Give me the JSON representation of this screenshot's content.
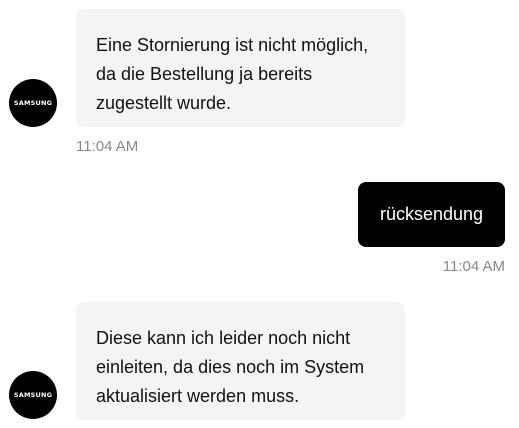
{
  "agent": {
    "name": "SAMSUNG",
    "avatar_icon": "samsung-logo-icon",
    "avatar_color": "#000000"
  },
  "messages": [
    {
      "sender": "agent",
      "text": "Eine Stornierung ist nicht möglich,\nda die Bestellung ja bereits\nzugestellt wurde.",
      "time": "11:04 AM"
    },
    {
      "sender": "user",
      "text": "rücksendung",
      "time": "11:04 AM"
    },
    {
      "sender": "agent",
      "text": "Diese kann ich leider noch nicht\neinleiten, da dies noch im System\naktualisiert werden muss.",
      "time": ""
    }
  ],
  "colors": {
    "agent_bubble": "#f4f4f4",
    "user_bubble": "#000000",
    "timestamp": "#888888"
  }
}
